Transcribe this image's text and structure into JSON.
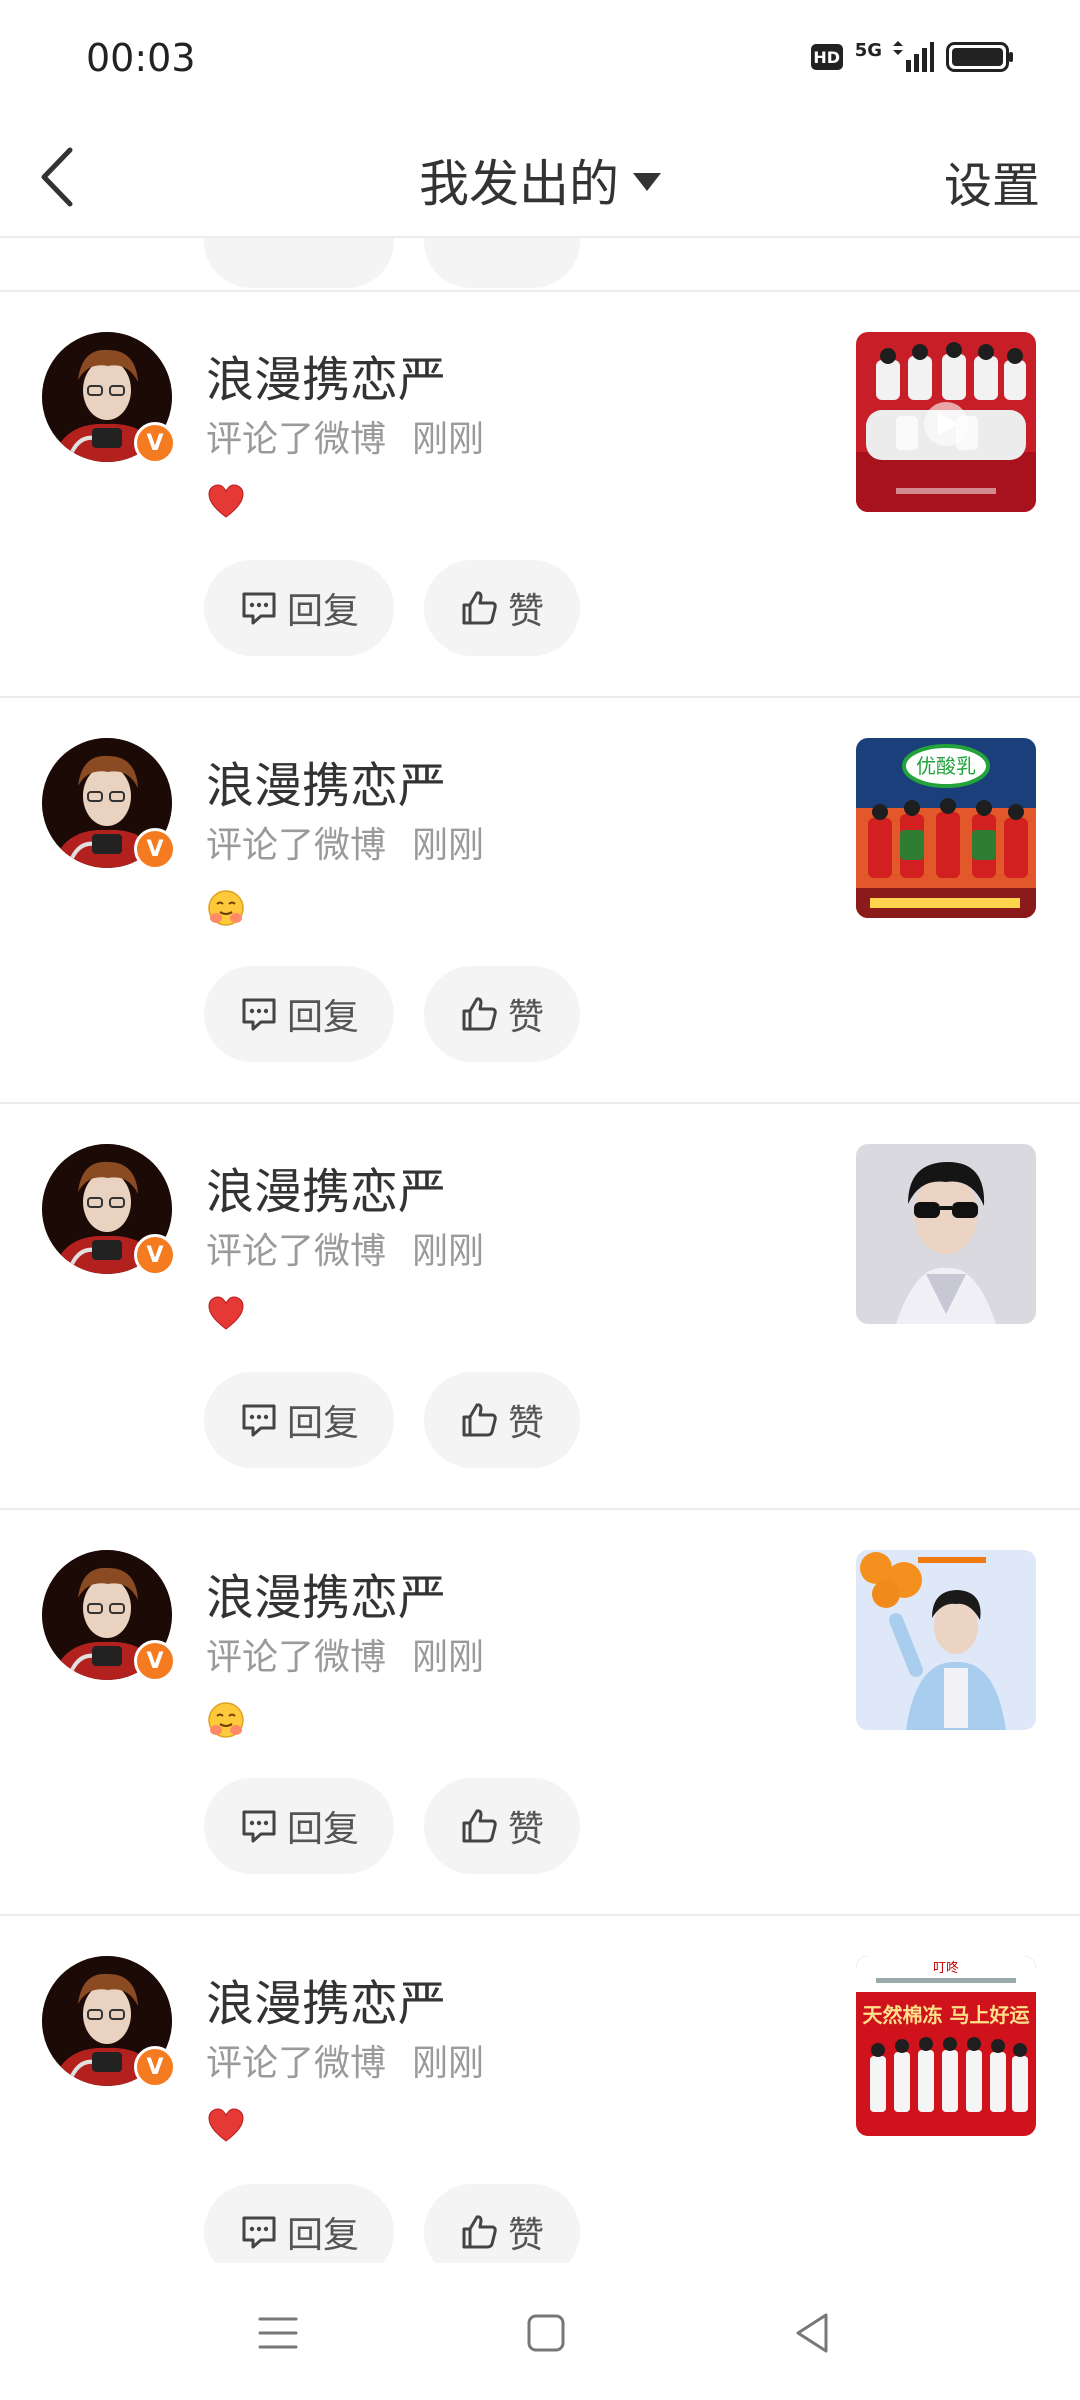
{
  "status_bar": {
    "time": "00:03",
    "hd": "HD",
    "network": "5G"
  },
  "header": {
    "title": "我发出的",
    "settings": "设置"
  },
  "icons": {
    "back": "chevron-left-icon",
    "dropdown": "caret-down-icon",
    "reply": "comment-bubble-icon",
    "like": "thumbs-up-icon",
    "verified": "verified-badge-icon"
  },
  "colors": {
    "accent": "#f47b1f",
    "text": "#333333",
    "muted": "#9a9a9a",
    "pill_bg": "#f4f4f4",
    "divider": "#ececec",
    "heart": "#e53935"
  },
  "notifications": [
    {
      "username": "浪漫携恋严",
      "action": "评论了微博",
      "time": "刚刚",
      "reaction": "heart-icon",
      "verified_badge": "V",
      "reply_label": "回复",
      "like_label": "赞"
    },
    {
      "username": "浪漫携恋严",
      "action": "评论了微博",
      "time": "刚刚",
      "reaction": "hugging-face-icon",
      "verified_badge": "V",
      "reply_label": "回复",
      "like_label": "赞"
    },
    {
      "username": "浪漫携恋严",
      "action": "评论了微博",
      "time": "刚刚",
      "reaction": "heart-icon",
      "verified_badge": "V",
      "reply_label": "回复",
      "like_label": "赞"
    },
    {
      "username": "浪漫携恋严",
      "action": "评论了微博",
      "time": "刚刚",
      "reaction": "hugging-face-icon",
      "verified_badge": "V",
      "reply_label": "回复",
      "like_label": "赞"
    },
    {
      "username": "浪漫携恋严",
      "action": "评论了微博",
      "time": "刚刚",
      "reaction": "heart-icon",
      "verified_badge": "V",
      "reply_label": "回复",
      "like_label": "赞"
    }
  ],
  "system_nav": {
    "menu": "menu-icon",
    "home": "home-icon",
    "back": "back-triangle-icon"
  }
}
